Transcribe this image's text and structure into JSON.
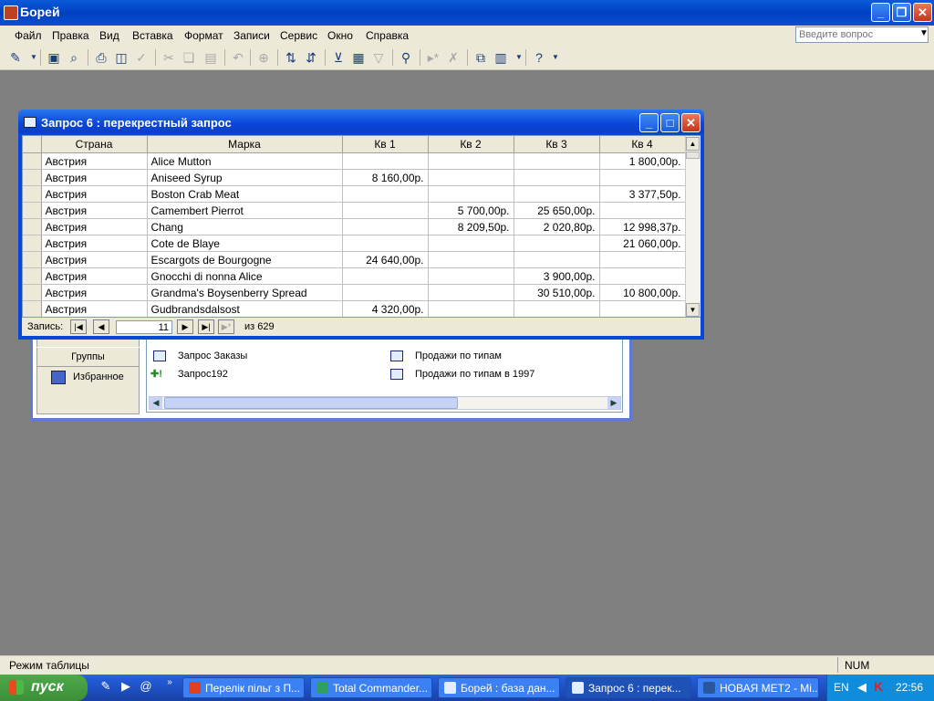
{
  "app": {
    "title": "Борей",
    "ask_placeholder": "Введите вопрос"
  },
  "menu": [
    "Файл",
    "Правка",
    "Вид",
    "Вставка",
    "Формат",
    "Записи",
    "Сервис",
    "Окно",
    "Справка"
  ],
  "toolbar_icons": [
    "design-view-icon",
    "save-icon",
    "print-icon",
    "print-preview-icon",
    "spelling-icon",
    "cut-icon",
    "copy-icon",
    "paste-icon",
    "undo-icon",
    "hyperlink-icon",
    "sort-ascending-icon",
    "sort-descending-icon",
    "filter-by-selection-icon",
    "filter-by-form-icon",
    "apply-filter-icon",
    "find-icon",
    "new-record-icon",
    "delete-record-icon",
    "database-window-icon",
    "new-object-icon",
    "help-icon"
  ],
  "query_window": {
    "title": "Запрос 6 : перекрестный запрос",
    "columns": [
      "Страна",
      "Марка",
      "Кв 1",
      "Кв 2",
      "Кв 3",
      "Кв 4"
    ],
    "rows": [
      {
        "country": "Австрия",
        "brand": "Alice Mutton",
        "q1": "",
        "q2": "",
        "q3": "",
        "q4": "1 800,00р."
      },
      {
        "country": "Австрия",
        "brand": "Aniseed Syrup",
        "q1": "8 160,00р.",
        "q2": "",
        "q3": "",
        "q4": ""
      },
      {
        "country": "Австрия",
        "brand": "Boston Crab Meat",
        "q1": "",
        "q2": "",
        "q3": "",
        "q4": "3 377,50р."
      },
      {
        "country": "Австрия",
        "brand": "Camembert Pierrot",
        "q1": "",
        "q2": "5 700,00р.",
        "q3": "25 650,00р.",
        "q4": ""
      },
      {
        "country": "Австрия",
        "brand": "Chang",
        "q1": "",
        "q2": "8 209,50р.",
        "q3": "2 020,80р.",
        "q4": "12 998,37р."
      },
      {
        "country": "Австрия",
        "brand": "Cote de Blaye",
        "q1": "",
        "q2": "",
        "q3": "",
        "q4": "21 060,00р."
      },
      {
        "country": "Австрия",
        "brand": "Escargots de Bourgogne",
        "q1": "24 640,00р.",
        "q2": "",
        "q3": "",
        "q4": ""
      },
      {
        "country": "Австрия",
        "brand": "Gnocchi di nonna Alice",
        "q1": "",
        "q2": "",
        "q3": "3 900,00р.",
        "q4": ""
      },
      {
        "country": "Австрия",
        "brand": "Grandma's Boysenberry Spread",
        "q1": "",
        "q2": "",
        "q3": "30 510,00р.",
        "q4": "10 800,00р."
      },
      {
        "country": "Австрия",
        "brand": "Gudbrandsdalsost",
        "q1": "4 320,00р.",
        "q2": "",
        "q3": "",
        "q4": ""
      }
    ],
    "nav": {
      "label": "Запись:",
      "current": "11",
      "of_label": "из",
      "total": "629"
    }
  },
  "db_window": {
    "groups_label": "Группы",
    "favorites_label": "Избранное",
    "objects_left": [
      "Запрос Заказы",
      "Запрос192"
    ],
    "objects_right": [
      "Продажи по типам",
      "Продажи по типам в 1997"
    ]
  },
  "status": {
    "mode": "Режим таблицы",
    "num": "NUM"
  },
  "taskbar": {
    "start_label": "пуск",
    "tasks": [
      "Перелік пільг з П...",
      "Total Commander...",
      "Борей : база дан...",
      "Запрос 6 : перек...",
      "НОВАЯ МЕТ2 - Mi..."
    ],
    "lang": "EN",
    "clock": "22:56"
  }
}
